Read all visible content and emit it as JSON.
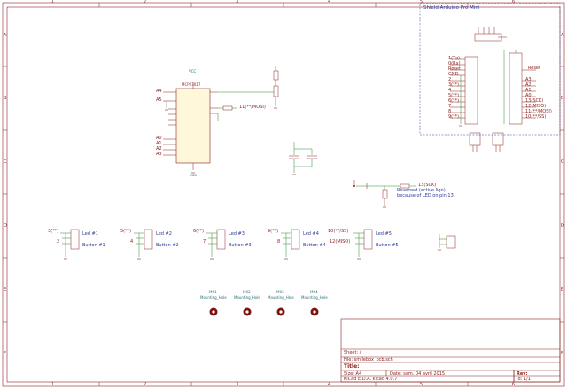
{
  "frame": {
    "columns": [
      "1",
      "2",
      "3",
      "4",
      "5",
      "6"
    ],
    "rows": [
      "A",
      "B",
      "C",
      "D",
      "E",
      "F"
    ]
  },
  "shield_box": {
    "title": "Shield Arduino Pro Mini"
  },
  "mcu": {
    "name": "MCP23017",
    "pins_left": [
      "A4",
      "A5",
      "A0",
      "A1",
      "A2",
      "A3"
    ],
    "reset_label": "Reset",
    "vcc": "VCC",
    "gnd": "GND"
  },
  "nets": {
    "mosi": "11(**/MOSI)",
    "sck": "13(SCK)",
    "miso": "12(MISO)"
  },
  "arduino_pins_left": [
    "1(Tx)",
    "0(Rx)",
    "Reset",
    "GND",
    "2",
    "3(**)",
    "4",
    "5(**)",
    "6(**)",
    "7",
    "8",
    "9(**)"
  ],
  "arduino_pins_right": [
    "Reset",
    "A3",
    "A2",
    "A1",
    "A0",
    "13(SCK)",
    "12(MISO)",
    "11(**/MOSI)",
    "10(**/SS)"
  ],
  "led_note": {
    "line1": "Reversed (active lign)",
    "line2": "because of LED on pin 13"
  },
  "buttons": [
    {
      "pin_top": "3(**)",
      "pin_mid": "2",
      "led": "Led #1",
      "btn": "Button #1"
    },
    {
      "pin_top": "5(**)",
      "pin_mid": "4",
      "led": "Led #2",
      "btn": "Button #2"
    },
    {
      "pin_top": "6(**)",
      "pin_mid": "7",
      "led": "Led #3",
      "btn": "Button #3"
    },
    {
      "pin_top": "9(**)",
      "pin_mid": "8",
      "led": "Led #4",
      "btn": "Button #4"
    },
    {
      "pin_top": "10(**/SS)",
      "pin_mid": "12(MISO)",
      "led": "Led #5",
      "btn": "Button #5"
    }
  ],
  "mounting": [
    {
      "ref": "MK1",
      "label": "Mounting_Hole"
    },
    {
      "ref": "MK2",
      "label": "Mounting_Hole"
    },
    {
      "ref": "MK3",
      "label": "Mounting_Hole"
    },
    {
      "ref": "MK4",
      "label": "Mounting_Hole"
    }
  ],
  "title_block": {
    "sheet": "Sheet: /",
    "file": "File: smilebox_pcb.sch",
    "title_label": "Title:",
    "size": "Size: A4",
    "date": "Date: sam. 04 avril 2015",
    "rev": "Rev:",
    "kicad": "KiCad E.D.A.  kicad 4.0.7",
    "id": "Id: 1/1"
  },
  "colors": {
    "wire": "#2a8a2a",
    "component": "#8b2020",
    "frame": "#8b2020",
    "note": "#2d3a9c"
  }
}
